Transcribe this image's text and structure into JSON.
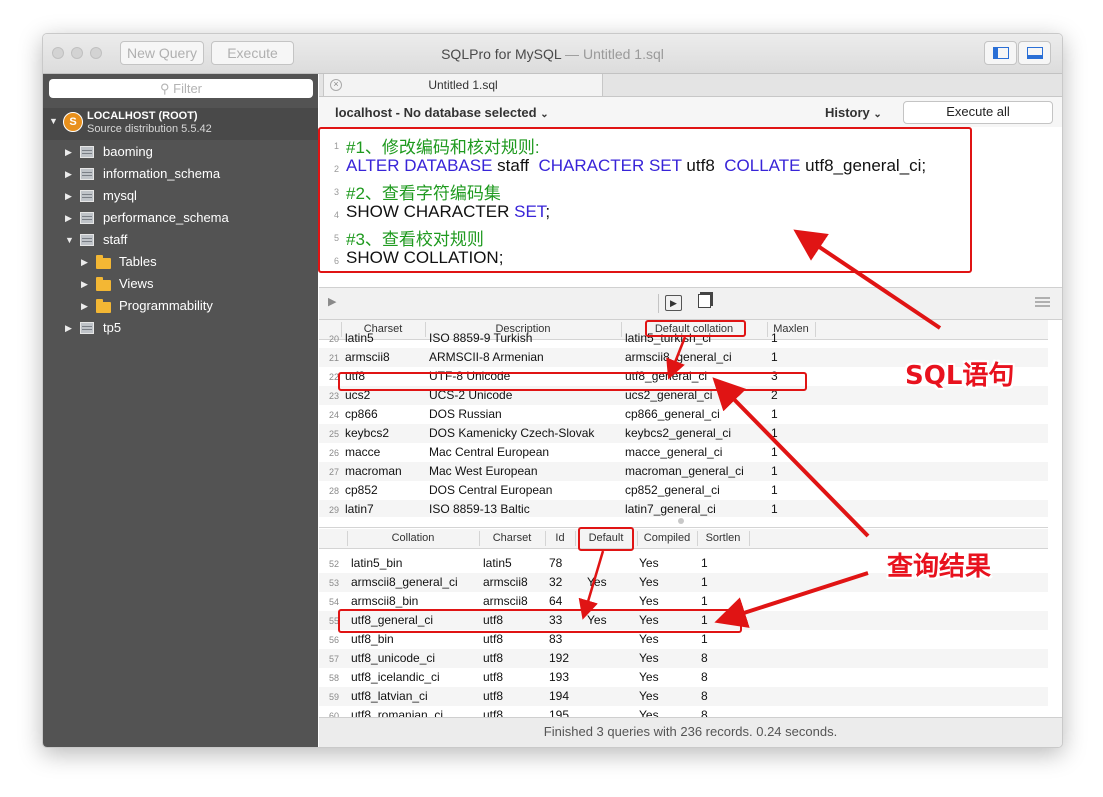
{
  "window": {
    "title": "SQLPro for MySQL",
    "title_sep": " — ",
    "document": "Untitled 1.sql",
    "new_query": "New Query",
    "execute": "Execute"
  },
  "sidebar": {
    "filter_placeholder": "Filter",
    "server": {
      "name": "LOCALHOST (ROOT)",
      "version": "Source distribution 5.5.42"
    },
    "databases": [
      "baoming",
      "information_schema",
      "mysql",
      "performance_schema",
      "staff",
      "tp5"
    ],
    "staff_children": [
      "Tables",
      "Views",
      "Programmability"
    ]
  },
  "tab": {
    "label": "Untitled 1.sql"
  },
  "context": {
    "database": "localhost - No database selected",
    "history": "History",
    "execute_all": "Execute all"
  },
  "editor": {
    "line_numbers": [
      "1",
      "2",
      "3",
      "4",
      "5",
      "6"
    ],
    "lines": [
      {
        "c1": "#1、修改编码和核对规则:"
      },
      {
        "k1": "ALTER DATABASE",
        "t1": " staff  ",
        "k2": "CHARACTER SET",
        "t2": " utf8  ",
        "k3": "COLLATE",
        "t3": " utf8_general_ci;"
      },
      {
        "c1": "#2、查看字符编码集"
      },
      {
        "t1": "SHOW CHARACTER ",
        "k1": "SET",
        "t2": ";"
      },
      {
        "c1": "#3、查看校对规则"
      },
      {
        "t1": "SHOW COLLATION;"
      }
    ]
  },
  "grid1": {
    "columns": [
      "Charset",
      "Description",
      "Default collation",
      "Maxlen"
    ],
    "rows": [
      {
        "n": "20",
        "c": [
          "latin5",
          "ISO 8859-9 Turkish",
          "latin5_turkish_ci",
          "1"
        ]
      },
      {
        "n": "21",
        "c": [
          "armscii8",
          "ARMSCII-8 Armenian",
          "armscii8_general_ci",
          "1"
        ]
      },
      {
        "n": "22",
        "c": [
          "utf8",
          "UTF-8 Unicode",
          "utf8_general_ci",
          "3"
        ]
      },
      {
        "n": "23",
        "c": [
          "ucs2",
          "UCS-2 Unicode",
          "ucs2_general_ci",
          "2"
        ]
      },
      {
        "n": "24",
        "c": [
          "cp866",
          "DOS Russian",
          "cp866_general_ci",
          "1"
        ]
      },
      {
        "n": "25",
        "c": [
          "keybcs2",
          "DOS Kamenicky Czech-Slovak",
          "keybcs2_general_ci",
          "1"
        ]
      },
      {
        "n": "26",
        "c": [
          "macce",
          "Mac Central European",
          "macce_general_ci",
          "1"
        ]
      },
      {
        "n": "27",
        "c": [
          "macroman",
          "Mac West European",
          "macroman_general_ci",
          "1"
        ]
      },
      {
        "n": "28",
        "c": [
          "cp852",
          "DOS Central European",
          "cp852_general_ci",
          "1"
        ]
      },
      {
        "n": "29",
        "c": [
          "latin7",
          "ISO 8859-13 Baltic",
          "latin7_general_ci",
          "1"
        ]
      }
    ]
  },
  "grid2": {
    "columns": [
      "Collation",
      "Charset",
      "Id",
      "Default",
      "Compiled",
      "Sortlen"
    ],
    "rows": [
      {
        "n": "52",
        "c": [
          "latin5_bin",
          "latin5",
          "78",
          "",
          "Yes",
          "1"
        ]
      },
      {
        "n": "53",
        "c": [
          "armscii8_general_ci",
          "armscii8",
          "32",
          "Yes",
          "Yes",
          "1"
        ]
      },
      {
        "n": "54",
        "c": [
          "armscii8_bin",
          "armscii8",
          "64",
          "",
          "Yes",
          "1"
        ]
      },
      {
        "n": "55",
        "c": [
          "utf8_general_ci",
          "utf8",
          "33",
          "Yes",
          "Yes",
          "1"
        ]
      },
      {
        "n": "56",
        "c": [
          "utf8_bin",
          "utf8",
          "83",
          "",
          "Yes",
          "1"
        ]
      },
      {
        "n": "57",
        "c": [
          "utf8_unicode_ci",
          "utf8",
          "192",
          "",
          "Yes",
          "8"
        ]
      },
      {
        "n": "58",
        "c": [
          "utf8_icelandic_ci",
          "utf8",
          "193",
          "",
          "Yes",
          "8"
        ]
      },
      {
        "n": "59",
        "c": [
          "utf8_latvian_ci",
          "utf8",
          "194",
          "",
          "Yes",
          "8"
        ]
      },
      {
        "n": "60",
        "c": [
          "utf8_romanian_ci",
          "utf8",
          "195",
          "",
          "Yes",
          "8"
        ]
      }
    ]
  },
  "status": "Finished 3 queries with 236 records. 0.24 seconds.",
  "annotations": {
    "sql": "SQL语句",
    "result": "查询结果"
  },
  "colors": {
    "keyword": "#3824d8",
    "comment": "#1f9a1f",
    "annotation": "#e8121e",
    "sidebar": "#535353"
  }
}
